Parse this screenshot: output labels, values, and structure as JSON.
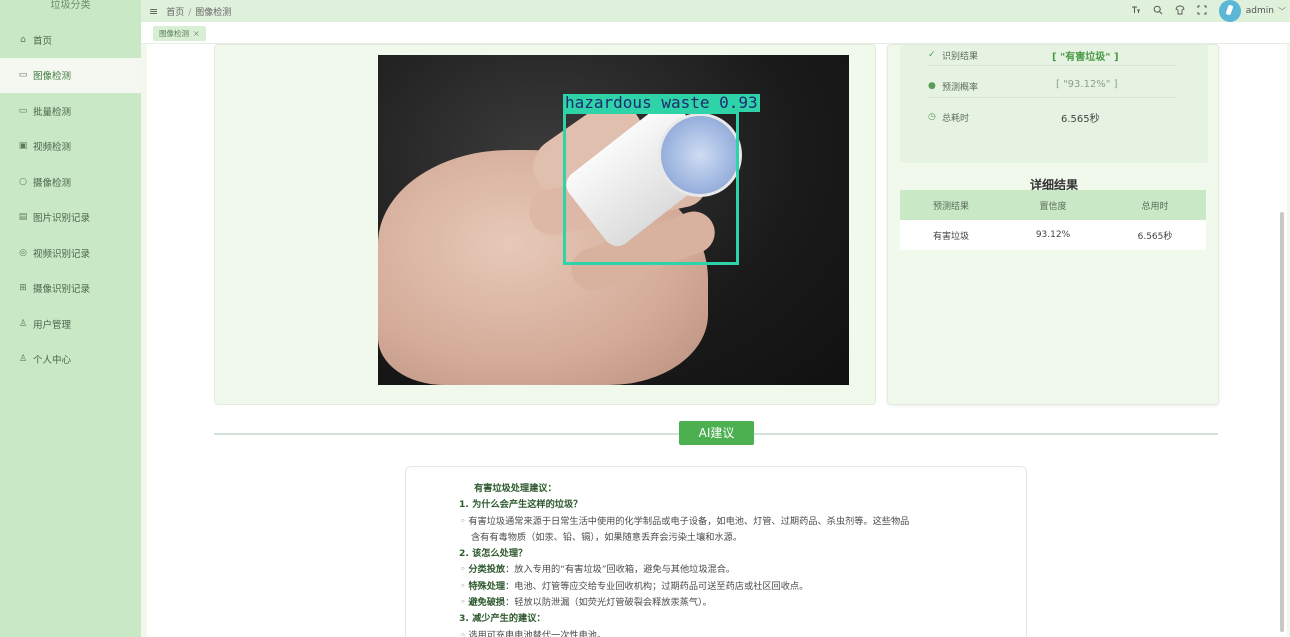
{
  "sidebar": {
    "brand": "垃圾分类",
    "items": [
      {
        "label": "首页",
        "icon": "⌂"
      },
      {
        "label": "图像检测",
        "icon": "▭",
        "active": true
      },
      {
        "label": "批量检测",
        "icon": "▭"
      },
      {
        "label": "视频检测",
        "icon": "▣"
      },
      {
        "label": "摄像检测",
        "icon": "○"
      },
      {
        "label": "图片识别记录",
        "icon": "▤"
      },
      {
        "label": "视频识别记录",
        "icon": "◎"
      },
      {
        "label": "摄像识别记录",
        "icon": "⊞"
      },
      {
        "label": "用户管理",
        "icon": "♙"
      },
      {
        "label": "个人中心",
        "icon": "♙"
      }
    ]
  },
  "topbar": {
    "menu_icon": "≡",
    "breadcrumb_home": "首页",
    "breadcrumb_sep": "/",
    "breadcrumb_current": "图像检测",
    "user": "admin",
    "caret": "﹀"
  },
  "tabs": [
    {
      "label": "图像检测",
      "close": "×"
    }
  ],
  "detection": {
    "label_text": "hazardous waste 0.93"
  },
  "stats": {
    "result_label": "识别结果",
    "result_value": "[ \"有害垃圾\" ]",
    "prob_label": "预测概率",
    "prob_value": "[ \"93.12%\" ]",
    "time_label": "总耗时",
    "time_value": "6.565秒"
  },
  "detail": {
    "title": "详细结果",
    "headers": [
      "预测结果",
      "置信度",
      "总用时"
    ],
    "rows": [
      [
        "有害垃圾",
        "93.12%",
        "6.565秒"
      ]
    ]
  },
  "ai": {
    "button": "AI建议",
    "heading": "有害垃圾处理建议：",
    "q1": "1. 为什么会产生这样的垃圾？",
    "a1_line1": "有害垃圾通常来源于日常生活中使用的化学制品或电子设备，如电池、灯管、过期药品、杀虫剂等。这些物品",
    "a1_line2": "含有有毒物质（如汞、铅、镉），如果随意丢弃会污染土壤和水源。",
    "q2": "2. 该怎么处理？",
    "b1_key": "分类投放",
    "b1_text": "：放入专用的“有害垃圾”回收箱，避免与其他垃圾混合。",
    "b2_key": "特殊处理",
    "b2_text": "：电池、灯管等应交给专业回收机构；过期药品可送至药店或社区回收点。",
    "b3_key": "避免破损",
    "b3_text": "：轻放以防泄漏（如荧光灯管破裂会释放汞蒸气）。",
    "q3": "3. 减少产生的建议：",
    "c1_text": "选用可充电电池替代一次性电池。"
  },
  "colors": {
    "sidebar_bg": "#c9e8c6",
    "accent_green": "#4caf50",
    "bbox_color": "#2fd3a8"
  }
}
